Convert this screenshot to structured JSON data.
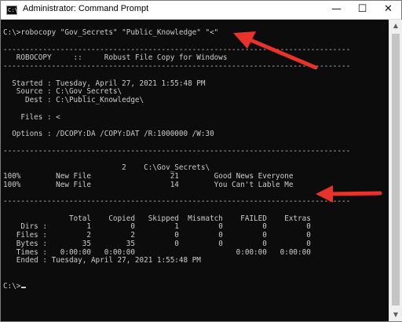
{
  "window": {
    "title": "Administrator: Command Prompt",
    "icon_text": "C:\\",
    "minimize_glyph": "—",
    "maximize_glyph": "☐",
    "close_glyph": "✕"
  },
  "console": {
    "lines": [
      "C:\\>robocopy \"Gov_Secrets\" \"Public_Knowledge\" \"<\"",
      "",
      "-------------------------------------------------------------------------------",
      "   ROBOCOPY     ::     Robust File Copy for Windows",
      "-------------------------------------------------------------------------------",
      "",
      "  Started : Tuesday, April 27, 2021 1:55:48 PM",
      "   Source : C:\\Gov_Secrets\\",
      "     Dest : C:\\Public_Knowledge\\",
      "",
      "    Files : <",
      "",
      "  Options : /DCOPY:DA /COPY:DAT /R:1000000 /W:30",
      "",
      "-------------------------------------------------------------------------------",
      "",
      "                           2    C:\\Gov_Secrets\\",
      "100%        New File                  21        Good News Everyone",
      "100%        New File                  14        You Can't Lable Me",
      "",
      "-------------------------------------------------------------------------------",
      "",
      "               Total    Copied   Skipped  Mismatch    FAILED    Extras",
      "    Dirs :         1         0         1         0         0         0",
      "   Files :         2         2         0         0         0         0",
      "   Bytes :        35        35         0         0         0         0",
      "   Times :   0:00:00   0:00:00                       0:00:00   0:00:00",
      "   Ended : Tuesday, April 27, 2021 1:55:48 PM",
      "",
      "",
      "C:\\>"
    ]
  },
  "annotations": {
    "arrow_color": "#e8332a"
  },
  "scrollbar": {
    "up_glyph": "▲",
    "down_glyph": "▼"
  }
}
